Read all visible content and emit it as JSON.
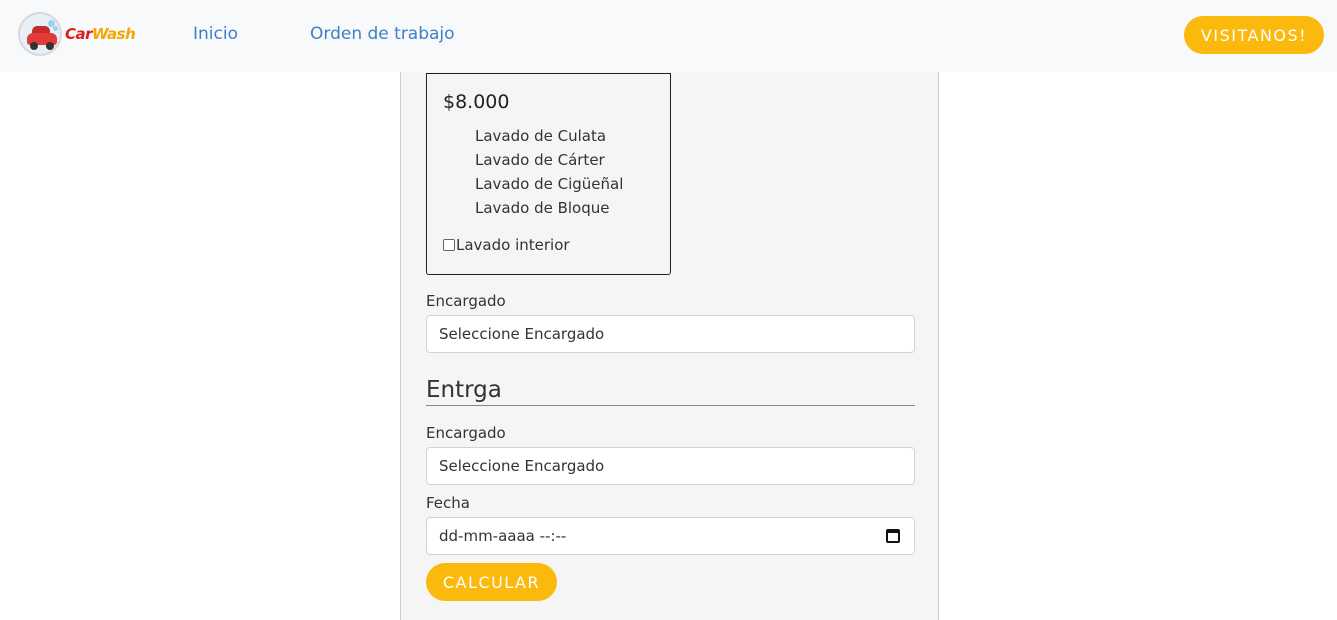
{
  "nav": {
    "logo": {
      "car": "Car",
      "wash": "Wash"
    },
    "links": [
      "Inicio",
      "Orden de trabajo"
    ],
    "cta": "VISITANOS!"
  },
  "option": {
    "price": "$8.000",
    "services": [
      "Lavado de Culata",
      "Lavado de Cárter",
      "Lavado de Cigüeñal",
      "Lavado de Bloque"
    ],
    "checkbox_label": "Lavado interior",
    "checkbox_checked": false
  },
  "recepcion": {
    "encargado_label": "Encargado",
    "encargado_value": "Seleccione Encargado"
  },
  "entrega": {
    "title": "Entrga",
    "encargado_label": "Encargado",
    "encargado_value": "Seleccione Encargado",
    "fecha_label": "Fecha",
    "fecha_value": "dd-mm-aaaa --:--"
  },
  "calcular_label": "CALCULAR",
  "colors": {
    "accent": "#fbb90d",
    "link": "#3d7fc8",
    "navbar": "#f8f9fa",
    "panel": "#f5f5f5"
  }
}
